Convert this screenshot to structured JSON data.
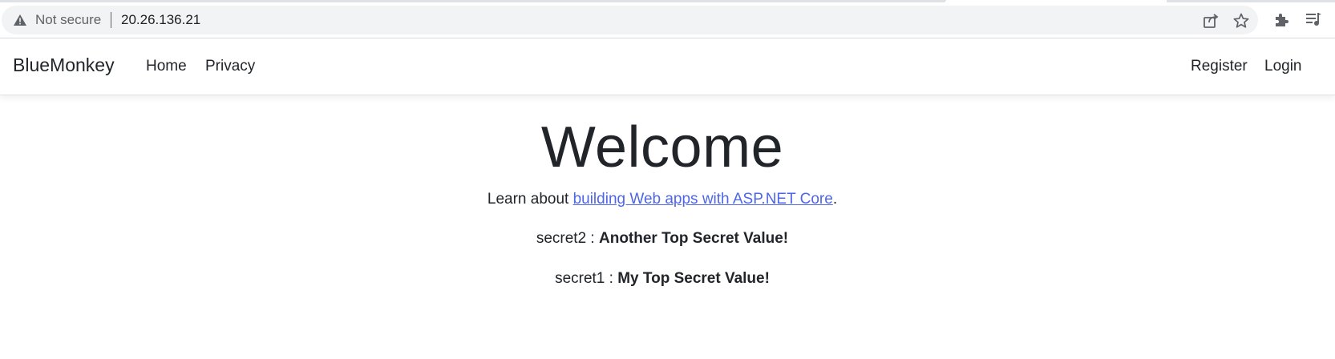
{
  "browser": {
    "security_label": "Not secure",
    "url": "20.26.136.21",
    "icons": [
      "warning-icon",
      "share-icon",
      "star-icon",
      "extensions-icon",
      "reading-list-icon"
    ]
  },
  "navbar": {
    "brand": "BlueMonkey",
    "links": [
      {
        "label": "Home"
      },
      {
        "label": "Privacy"
      }
    ],
    "right_links": [
      {
        "label": "Register"
      },
      {
        "label": "Login"
      }
    ]
  },
  "main": {
    "heading": "Welcome",
    "learn_prefix": "Learn about ",
    "learn_link": "building Web apps with ASP.NET Core",
    "learn_suffix": ".",
    "secrets": [
      {
        "key": "secret2",
        "separator": " : ",
        "value": "Another Top Secret Value!"
      },
      {
        "key": "secret1",
        "separator": " : ",
        "value": "My Top Secret Value!"
      }
    ]
  },
  "colors": {
    "link": "#4f66e8",
    "text": "#212529",
    "omnibox": "#f1f3f4"
  }
}
